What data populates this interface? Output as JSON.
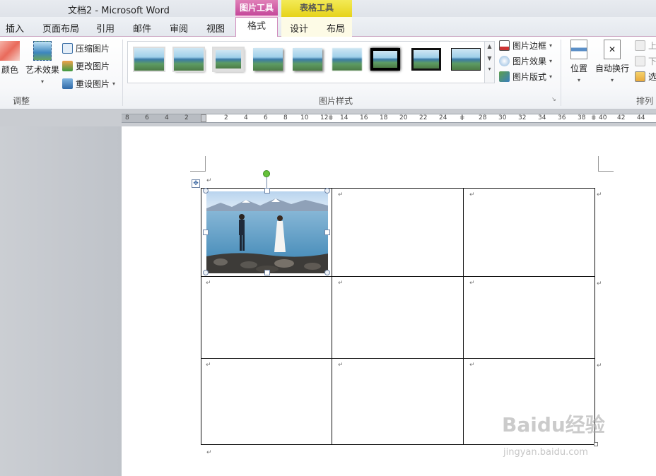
{
  "window": {
    "title": "文档2  -  Microsoft Word"
  },
  "contextual_tabs": {
    "picture_tools": "图片工具",
    "table_tools": "表格工具"
  },
  "tabs": [
    "插入",
    "页面布局",
    "引用",
    "邮件",
    "审阅",
    "视图",
    "格式",
    "设计",
    "布局"
  ],
  "active_tab": "格式",
  "ribbon": {
    "adjust": {
      "color_label": "颜色",
      "artistic_label": "艺术效果",
      "compress_label": "压缩图片",
      "change_label": "更改图片",
      "reset_label": "重设图片",
      "group_label": "调整"
    },
    "styles": {
      "group_label": "图片样式",
      "border_label": "图片边框",
      "effects_label": "图片效果",
      "layout_label": "图片版式"
    },
    "arrange": {
      "position_label": "位置",
      "wrap_label": "自动换行",
      "bring_forward_label": "上",
      "send_backward_label": "下",
      "selection_label": "选",
      "group_label": "排列"
    }
  },
  "ruler": {
    "numbers": [
      "8",
      "6",
      "4",
      "2",
      "2",
      "4",
      "6",
      "8",
      "10",
      "12",
      "14",
      "16",
      "18",
      "20",
      "22",
      "24",
      "28",
      "30",
      "32",
      "34",
      "36",
      "38",
      "40",
      "42",
      "44"
    ]
  },
  "document": {
    "pilcrow": "↵",
    "table": {
      "rows": 3,
      "cols": 3,
      "first_cell_content": "photo"
    }
  },
  "watermark": {
    "brand": "Baidu经验",
    "url": "jingyan.baidu.com"
  },
  "colors": {
    "picture_tools_accent": "#c5479a",
    "table_tools_accent": "#e6d31a",
    "rotate_handle": "#66c23a"
  }
}
